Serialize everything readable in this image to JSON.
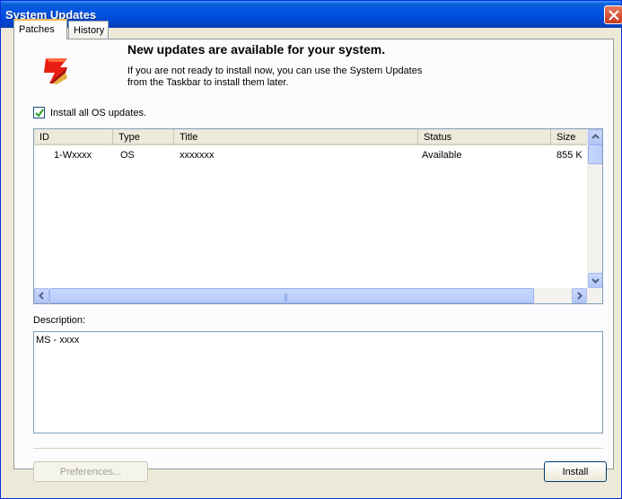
{
  "window": {
    "title": "System Updates"
  },
  "tabs": [
    {
      "label": "Patches",
      "active": true
    },
    {
      "label": "History",
      "active": false
    }
  ],
  "header": {
    "title": "New updates are available for your system.",
    "desc_line1": "If you are not ready to install now, you can use the System Updates",
    "desc_line2": "from the Taskbar to install them later.",
    "icon": "updates-icon"
  },
  "install_all": {
    "label": "Install all OS updates.",
    "checked": true
  },
  "list": {
    "columns": [
      "ID",
      "Type",
      "Title",
      "Status",
      "Size"
    ],
    "rows": [
      {
        "id": "1-Wxxxx",
        "type": "OS",
        "title": "xxxxxxx",
        "status": "Available",
        "size": "855 K"
      }
    ]
  },
  "description": {
    "label": "Description:",
    "value": "MS - xxxx"
  },
  "buttons": {
    "preferences": "Preferences...",
    "install": "Install"
  },
  "colors": {
    "titlebar": "#0355e2",
    "dialog_bg": "#ece9d8",
    "tab_highlight": "#f7b95a"
  }
}
